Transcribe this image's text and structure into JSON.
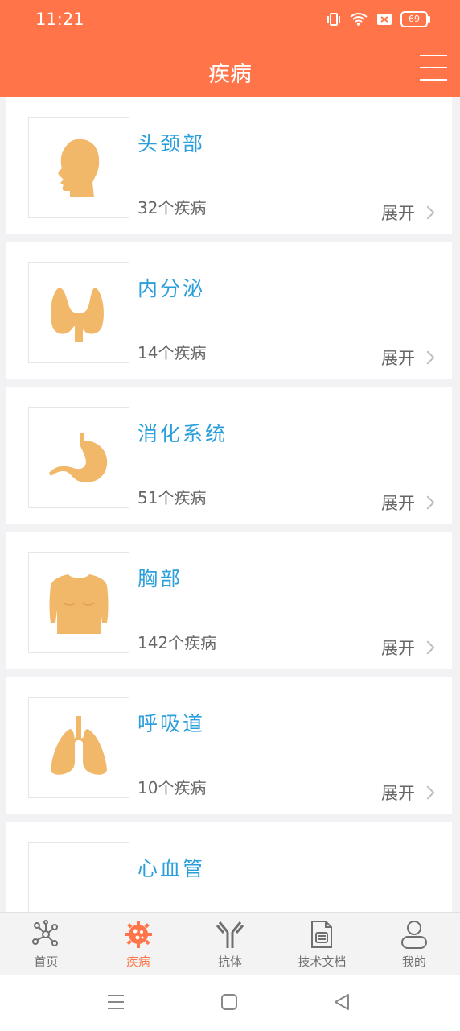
{
  "status": {
    "time": "11:21",
    "battery": "69"
  },
  "header": {
    "title": "疾病"
  },
  "categories": [
    {
      "title": "头颈部",
      "count": "32个疾病",
      "expand": "展开",
      "icon": "head-icon"
    },
    {
      "title": "内分泌",
      "count": "14个疾病",
      "expand": "展开",
      "icon": "thyroid-icon"
    },
    {
      "title": "消化系统",
      "count": "51个疾病",
      "expand": "展开",
      "icon": "stomach-icon"
    },
    {
      "title": "胸部",
      "count": "142个疾病",
      "expand": "展开",
      "icon": "chest-icon"
    },
    {
      "title": "呼吸道",
      "count": "10个疾病",
      "expand": "展开",
      "icon": "lungs-icon"
    },
    {
      "title": "心血管",
      "count": "",
      "expand": "",
      "icon": ""
    }
  ],
  "tabs": [
    {
      "label": "首页",
      "icon": "network-icon"
    },
    {
      "label": "疾病",
      "icon": "virus-icon",
      "active": true
    },
    {
      "label": "抗体",
      "icon": "antibody-icon"
    },
    {
      "label": "技术文档",
      "icon": "document-icon"
    },
    {
      "label": "我的",
      "icon": "user-icon"
    }
  ],
  "colors": {
    "accent": "#ff7448",
    "title_blue": "#2b9fdc",
    "organ": "#f1b869"
  }
}
